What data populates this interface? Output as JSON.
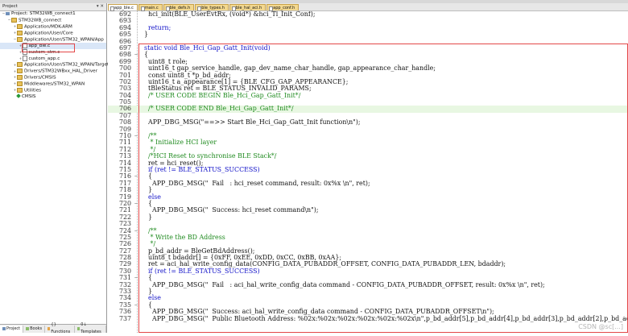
{
  "project_panel": {
    "header": "Project",
    "tree": [
      {
        "label": "Project: STM32WB_connect1",
        "depth": 0,
        "icon": "project-icon",
        "expander": "−"
      },
      {
        "label": "STM32WB_connect",
        "depth": 1,
        "icon": "folder-icon",
        "expander": "−"
      },
      {
        "label": "Application/MDK-ARM",
        "depth": 2,
        "icon": "folder-icon",
        "expander": "+"
      },
      {
        "label": "Application/User/Core",
        "depth": 2,
        "icon": "folder-icon",
        "expander": "+"
      },
      {
        "label": "Application/User/STM32_WPAN/App",
        "depth": 2,
        "icon": "folder-icon",
        "expander": "−"
      },
      {
        "label": "app_ble.c",
        "depth": 3,
        "icon": "file-icon",
        "expander": "+"
      },
      {
        "label": "custom_stm.c",
        "depth": 3,
        "icon": "file-icon",
        "expander": "+"
      },
      {
        "label": "custom_app.c",
        "depth": 3,
        "icon": "file-icon",
        "expander": "+"
      },
      {
        "label": "Application/User/STM32_WPAN/Target",
        "depth": 2,
        "icon": "folder-icon",
        "expander": "+"
      },
      {
        "label": "Drivers/STM32WBxx_HAL_Driver",
        "depth": 2,
        "icon": "folder-icon",
        "expander": "+"
      },
      {
        "label": "Drivers/CMSIS",
        "depth": 2,
        "icon": "folder-icon",
        "expander": "+"
      },
      {
        "label": "Middlewares/STM32_WPAN",
        "depth": 2,
        "icon": "folder-icon",
        "expander": "+"
      },
      {
        "label": "Utilities",
        "depth": 2,
        "icon": "folder-icon",
        "expander": "+"
      },
      {
        "label": "CMSIS",
        "depth": 2,
        "icon": "cmsis-icon",
        "expander": ""
      }
    ],
    "bottom_tabs": [
      "Project",
      "Books",
      "{} Functions",
      "0↓ Templates"
    ]
  },
  "editor": {
    "tabs": [
      "app_ble.c",
      "main.c",
      "ble_defs.h",
      "ble_types.h",
      "ble_hal_aci.h",
      "app_conf.h"
    ],
    "active_tab": 0,
    "lines": [
      {
        "n": "692",
        "g": "",
        "t": "    hci_init(BLE_UserEvtRx, (void*) &hci_Tl_Init_Conf);"
      },
      {
        "n": "693",
        "g": "",
        "t": ""
      },
      {
        "n": "694",
        "g": "",
        "t": "    return;"
      },
      {
        "n": "695",
        "g": "",
        "t": "  }"
      },
      {
        "n": "696",
        "g": "",
        "t": ""
      },
      {
        "n": "697",
        "g": "",
        "t": "  static void Ble_Hci_Gap_Gatt_Init(void)"
      },
      {
        "n": "698",
        "g": "−",
        "t": "  {"
      },
      {
        "n": "699",
        "g": "",
        "t": "    uint8_t role;"
      },
      {
        "n": "700",
        "g": "",
        "t": "    uint16_t gap_service_handle, gap_dev_name_char_handle, gap_appearance_char_handle;"
      },
      {
        "n": "701",
        "g": "",
        "t": "    const uint8_t *p_bd_addr;"
      },
      {
        "n": "702",
        "g": "",
        "t": "    uint16_t a_appearance[1] = {BLE_CFG_GAP_APPEARANCE};"
      },
      {
        "n": "703",
        "g": "",
        "t": "    tBleStatus ret = BLE_STATUS_INVALID_PARAMS;"
      },
      {
        "n": "704",
        "g": "",
        "t": "    /* USER CODE BEGIN Ble_Hci_Gap_Gatt_Init*/"
      },
      {
        "n": "705",
        "g": "",
        "t": ""
      },
      {
        "n": "706",
        "g": "",
        "t": "    /* USER CODE END Ble_Hci_Gap_Gatt_Init*/"
      },
      {
        "n": "707",
        "g": "",
        "t": ""
      },
      {
        "n": "708",
        "g": "",
        "t": "    APP_DBG_MSG(\"==>> Start Ble_Hci_Gap_Gatt_Init function\\n\");"
      },
      {
        "n": "709",
        "g": "",
        "t": ""
      },
      {
        "n": "710",
        "g": "−",
        "t": "    /**"
      },
      {
        "n": "711",
        "g": "",
        "t": "     * Initialize HCI layer"
      },
      {
        "n": "712",
        "g": "",
        "t": "     */"
      },
      {
        "n": "713",
        "g": "",
        "t": "    /*HCI Reset to synchronise BLE Stack*/"
      },
      {
        "n": "714",
        "g": "",
        "t": "    ret = hci_reset();"
      },
      {
        "n": "715",
        "g": "",
        "t": "    if (ret != BLE_STATUS_SUCCESS)"
      },
      {
        "n": "716",
        "g": "−",
        "t": "    {"
      },
      {
        "n": "717",
        "g": "",
        "t": "      APP_DBG_MSG(\"  Fail   : hci_reset command, result: 0x%x \\n\", ret);"
      },
      {
        "n": "718",
        "g": "",
        "t": "    }"
      },
      {
        "n": "719",
        "g": "",
        "t": "    else"
      },
      {
        "n": "720",
        "g": "−",
        "t": "    {"
      },
      {
        "n": "721",
        "g": "",
        "t": "      APP_DBG_MSG(\"  Success: hci_reset command\\n\");"
      },
      {
        "n": "722",
        "g": "",
        "t": "    }"
      },
      {
        "n": "723",
        "g": "",
        "t": ""
      },
      {
        "n": "724",
        "g": "−",
        "t": "    /**"
      },
      {
        "n": "725",
        "g": "",
        "t": "     * Write the BD Address"
      },
      {
        "n": "726",
        "g": "",
        "t": "     */"
      },
      {
        "n": "727",
        "g": "",
        "t": "    p_bd_addr = BleGetBdAddress();"
      },
      {
        "n": "728",
        "g": "",
        "t": "    uint8_t bdaddr[] = {0xFF, 0xEE, 0xDD, 0xCC, 0xBB, 0xAA};"
      },
      {
        "n": "729",
        "g": "",
        "t": "    ret = aci_hal_write_config_data(CONFIG_DATA_PUBADDR_OFFSET, CONFIG_DATA_PUBADDR_LEN, bdaddr);"
      },
      {
        "n": "730",
        "g": "",
        "t": "    if (ret != BLE_STATUS_SUCCESS)"
      },
      {
        "n": "731",
        "g": "−",
        "t": "    {"
      },
      {
        "n": "732",
        "g": "",
        "t": "      APP_DBG_MSG(\"  Fail   : aci_hal_write_config_data command - CONFIG_DATA_PUBADDR_OFFSET, result: 0x%x \\n\", ret);"
      },
      {
        "n": "733",
        "g": "",
        "t": "    }"
      },
      {
        "n": "734",
        "g": "",
        "t": "    else"
      },
      {
        "n": "735",
        "g": "−",
        "t": "    {"
      },
      {
        "n": "736",
        "g": "",
        "t": "      APP_DBG_MSG(\"  Success: aci_hal_write_config_data command - CONFIG_DATA_PUBADDR_OFFSET\\n\");"
      },
      {
        "n": "737",
        "g": "",
        "t": "      APP_DBG_MSG(\"  Public Bluetooth Address: %02x:%02x:%02x:%02x:%02x:%02x\\n\",p_bd_addr[5],p_bd_addr[4],p_bd_addr[3],p_bd_addr[2],p_bd_addr[1],p_bd_"
      }
    ],
    "highlighted_lines": [
      "706"
    ],
    "watermark": "CSDN @sc[...]"
  },
  "colors": {
    "annotation_red": "#e34848",
    "comment_green": "#1e8a1e",
    "keyword_blue": "#1010c8",
    "highlight_green": "#e8f7e2"
  }
}
